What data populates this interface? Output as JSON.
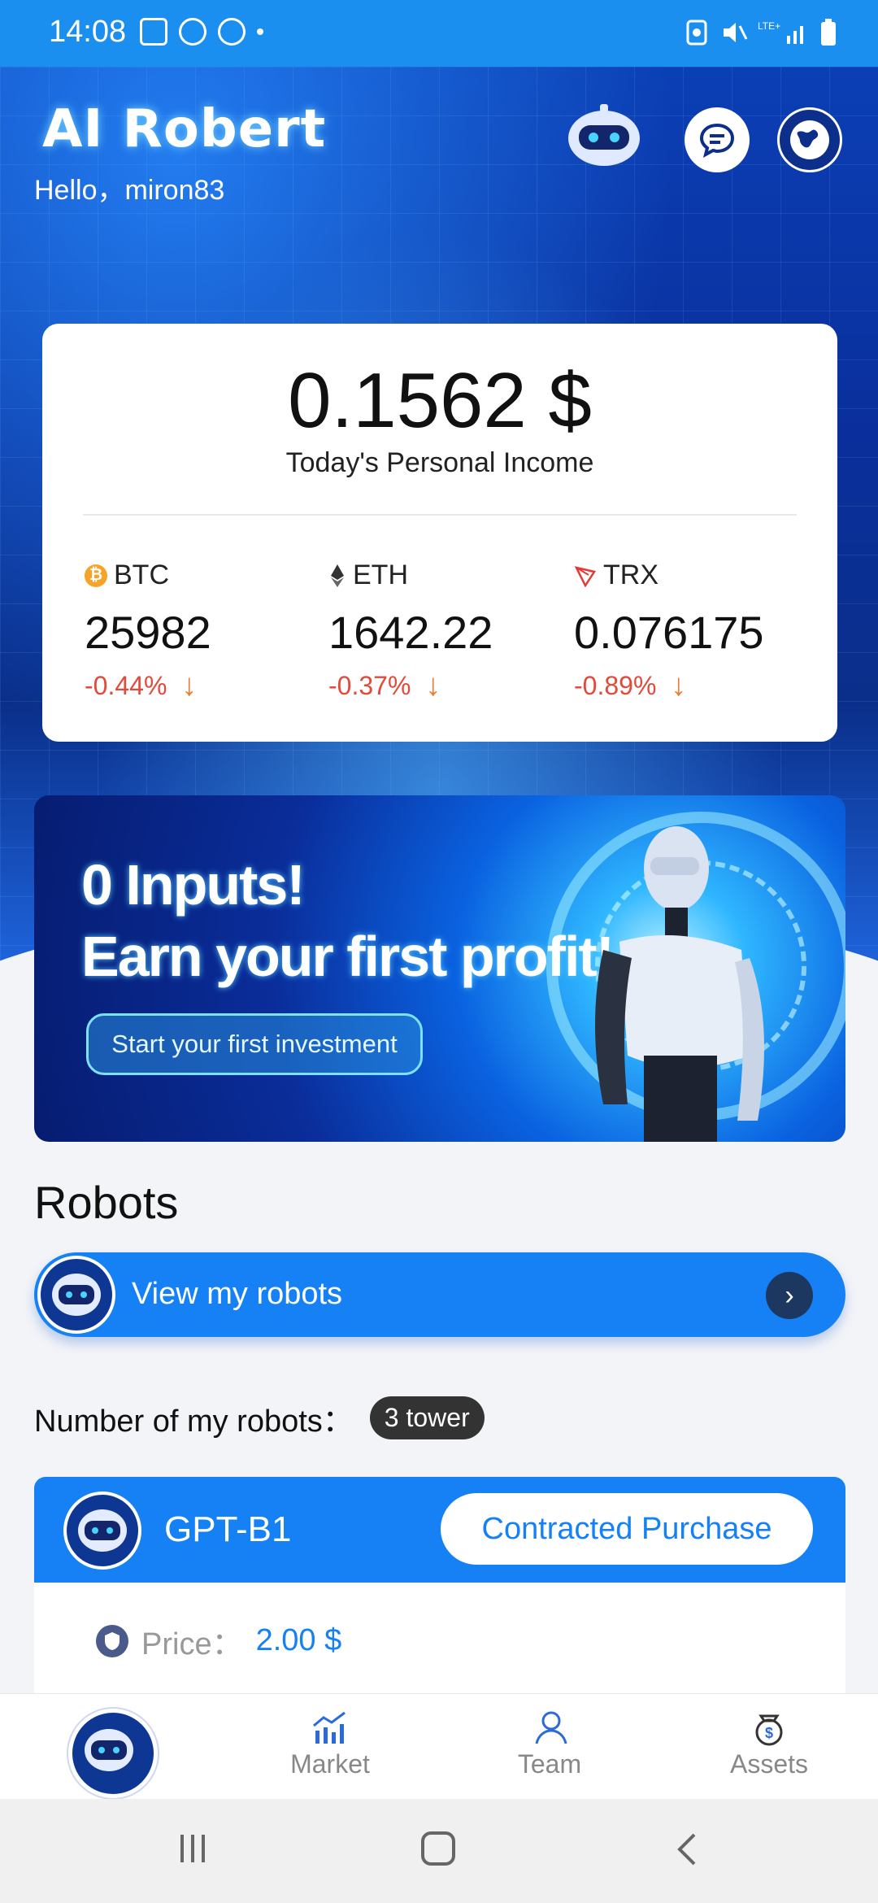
{
  "status_bar": {
    "time": "14:08"
  },
  "header": {
    "brand": "AI Robert",
    "greeting": "Hello，miron83"
  },
  "income": {
    "amount": "0.1562 $",
    "label": "Today's Personal Income",
    "coins": [
      {
        "symbol": "BTC",
        "price": "25982",
        "change": "-0.44%",
        "icon": "bitcoin-icon"
      },
      {
        "symbol": "ETH",
        "price": "1642.22",
        "change": "-0.37%",
        "icon": "ethereum-icon"
      },
      {
        "symbol": "TRX",
        "price": "0.076175",
        "change": "-0.89%",
        "icon": "tron-icon"
      }
    ]
  },
  "banner": {
    "line1": "0 Inputs!",
    "line2": "Earn your first profit!",
    "cta": "Start your first investment"
  },
  "robots": {
    "title": "Robots",
    "view_label": "View my robots",
    "count_label": "Number of my robots：",
    "count_value": "3 tower",
    "card": {
      "name": "GPT-B1",
      "buy_label": "Contracted Purchase",
      "price_label": "Price：",
      "price_value": "2.00 $"
    }
  },
  "bottom_nav": {
    "items": [
      {
        "label": "Market",
        "icon": "market-chart-icon"
      },
      {
        "label": "Team",
        "icon": "team-user-icon"
      },
      {
        "label": "Assets",
        "icon": "assets-money-bag-icon"
      }
    ]
  },
  "colors": {
    "primary": "#1581f4",
    "negative": "#e24a3b",
    "arrow": "#f07b2e"
  }
}
